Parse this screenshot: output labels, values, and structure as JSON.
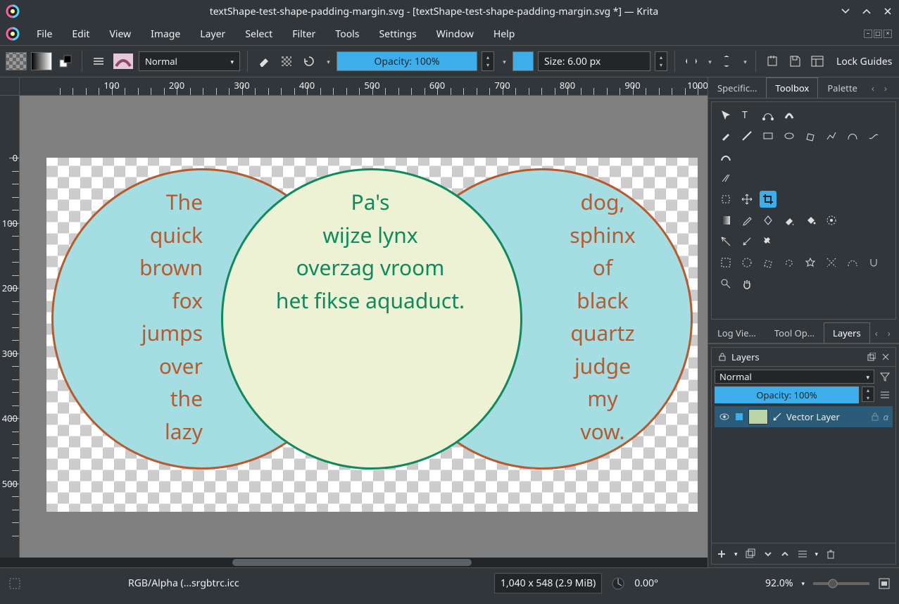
{
  "window": {
    "title": "textShape-test-shape-padding-margin.svg - [textShape-test-shape-padding-margin.svg *] — Krita"
  },
  "menubar": [
    "File",
    "Edit",
    "View",
    "Image",
    "Layer",
    "Select",
    "Filter",
    "Tools",
    "Settings",
    "Window",
    "Help"
  ],
  "toolbar": {
    "blend_mode": "Normal",
    "opacity_label": "Opacity: 100%",
    "size_label": "Size: 6.00 px",
    "lock_guides": "Lock Guides"
  },
  "ruler_h": [
    "100",
    "200",
    "300",
    "400",
    "500",
    "600",
    "700",
    "800",
    "900",
    "1000"
  ],
  "ruler_v": [
    "0",
    "100",
    "200",
    "300",
    "400",
    "500"
  ],
  "canvas": {
    "left_text": "The\nquick\nbrown\nfox\njumps\nover\nthe\nlazy",
    "mid_text": "Pa's\nwijze lynx\noverzag vroom\nhet fikse aquaduct.",
    "right_text": "dog,\nsphinx\nof\nblack\nquartz\njudge\nmy\nvow."
  },
  "right_tabs_top": {
    "specific": "Specific…",
    "toolbox": "Toolbox",
    "palette": "Palette"
  },
  "right_tabs_mid": {
    "logview": "Log Vie…",
    "toolop": "Tool Op…",
    "layers": "Layers"
  },
  "layers": {
    "title": "Layers",
    "blend": "Normal",
    "opacity": "Opacity:  100%",
    "layer_name": "Vector Layer"
  },
  "statusbar": {
    "colorspace": "RGB/Alpha (...srgbtrc.icc",
    "dimensions": "1,040 x 548 (2.9 MiB)",
    "rotation": "0.00°",
    "zoom": "92.0%"
  }
}
